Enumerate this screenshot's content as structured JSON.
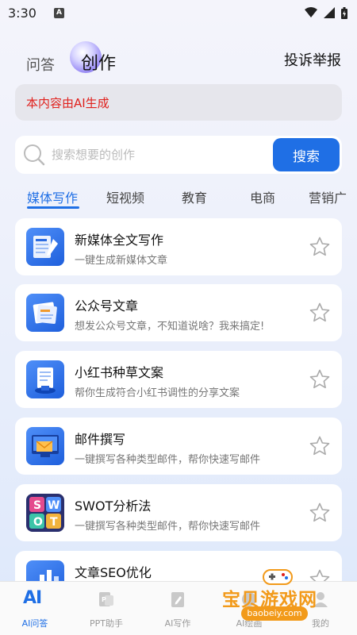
{
  "status_bar": {
    "time": "3:30",
    "notification_badge": "A"
  },
  "header": {
    "tab_qa": "问答",
    "tab_create": "创作",
    "report": "投诉举报"
  },
  "notice": {
    "text": "本内容由AI生成"
  },
  "search": {
    "placeholder": "搜索想要的创作",
    "button": "搜索"
  },
  "categories": [
    {
      "label": "媒体写作",
      "active": true
    },
    {
      "label": "短视频",
      "active": false
    },
    {
      "label": "教育",
      "active": false
    },
    {
      "label": "电商",
      "active": false
    },
    {
      "label": "营销广",
      "active": false
    }
  ],
  "cards": [
    {
      "title": "新媒体全文写作",
      "subtitle": "一键生成新媒体文章",
      "icon": "news-writing-icon"
    },
    {
      "title": "公众号文章",
      "subtitle": "想发公众号文章，不知道说啥？我来搞定!",
      "icon": "article-icon"
    },
    {
      "title": "小红书种草文案",
      "subtitle": "帮你生成符合小红书调性的分享文案",
      "icon": "notebook-icon"
    },
    {
      "title": "邮件撰写",
      "subtitle": "一键撰写各种类型邮件，帮你快速写邮件",
      "icon": "email-icon"
    },
    {
      "title": "SWOT分析法",
      "subtitle": "一键撰写各种类型邮件，帮你快速写邮件",
      "icon": "swot-icon"
    },
    {
      "title": "文章SEO优化",
      "subtitle": "",
      "icon": "seo-icon"
    }
  ],
  "bottom_nav": [
    {
      "label": "AI问答",
      "glyph": "AI",
      "active": true
    },
    {
      "label": "PPT助手",
      "active": false
    },
    {
      "label": "AI写作",
      "active": false
    },
    {
      "label": "AI绘画",
      "active": false
    },
    {
      "label": "我的",
      "active": false
    }
  ],
  "watermark": {
    "text": "宝贝游戏网",
    "url": "baobeiy.com"
  },
  "colors": {
    "accent": "#1f6fe5",
    "notice_text": "#e0201c",
    "watermark": "#f29a1a"
  }
}
